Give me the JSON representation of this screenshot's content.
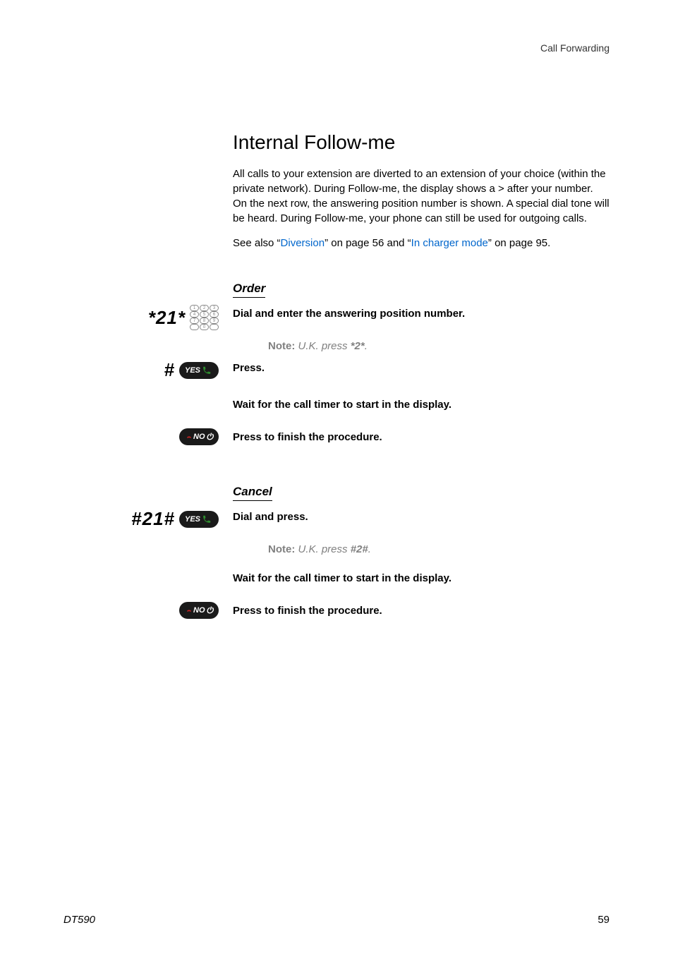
{
  "header": {
    "section": "Call Forwarding"
  },
  "title": "Internal Follow-me",
  "intro": "All calls to your extension are diverted to an extension of your choice (within the private network). During Follow-me, the display shows a > after your number. On the next row, the answering position number is shown. A special dial tone will be heard. During Follow-me, your phone can still be used for outgoing calls.",
  "seealso": {
    "pre": "See also “",
    "link1": "Diversion",
    "mid1": "” on page 56 and “",
    "link2": "In charger mode",
    "mid2": "” on page 95."
  },
  "order": {
    "heading": "Order",
    "step1": {
      "code": "*21*",
      "text": "Dial and enter the answering position number.",
      "note_label": "Note:",
      "note_text_pre": "U.K. press ",
      "note_code": "*2*",
      "note_text_post": "."
    },
    "step2": {
      "code": "#",
      "text": "Press."
    },
    "step3": {
      "text": "Wait for the call timer to start in the display."
    },
    "step4": {
      "text": "Press to finish the procedure."
    }
  },
  "cancel": {
    "heading": "Cancel",
    "step1": {
      "code": "#21#",
      "text": "Dial and press.",
      "note_label": "Note:",
      "note_text_pre": "U.K. press ",
      "note_code": "#2#",
      "note_text_post": "."
    },
    "step2": {
      "text": "Wait for the call timer to start in the display."
    },
    "step3": {
      "text": "Press to finish the procedure."
    }
  },
  "footer": {
    "model": "DT590",
    "page": "59"
  },
  "icons": {
    "yes": "YES",
    "no": "NO"
  }
}
